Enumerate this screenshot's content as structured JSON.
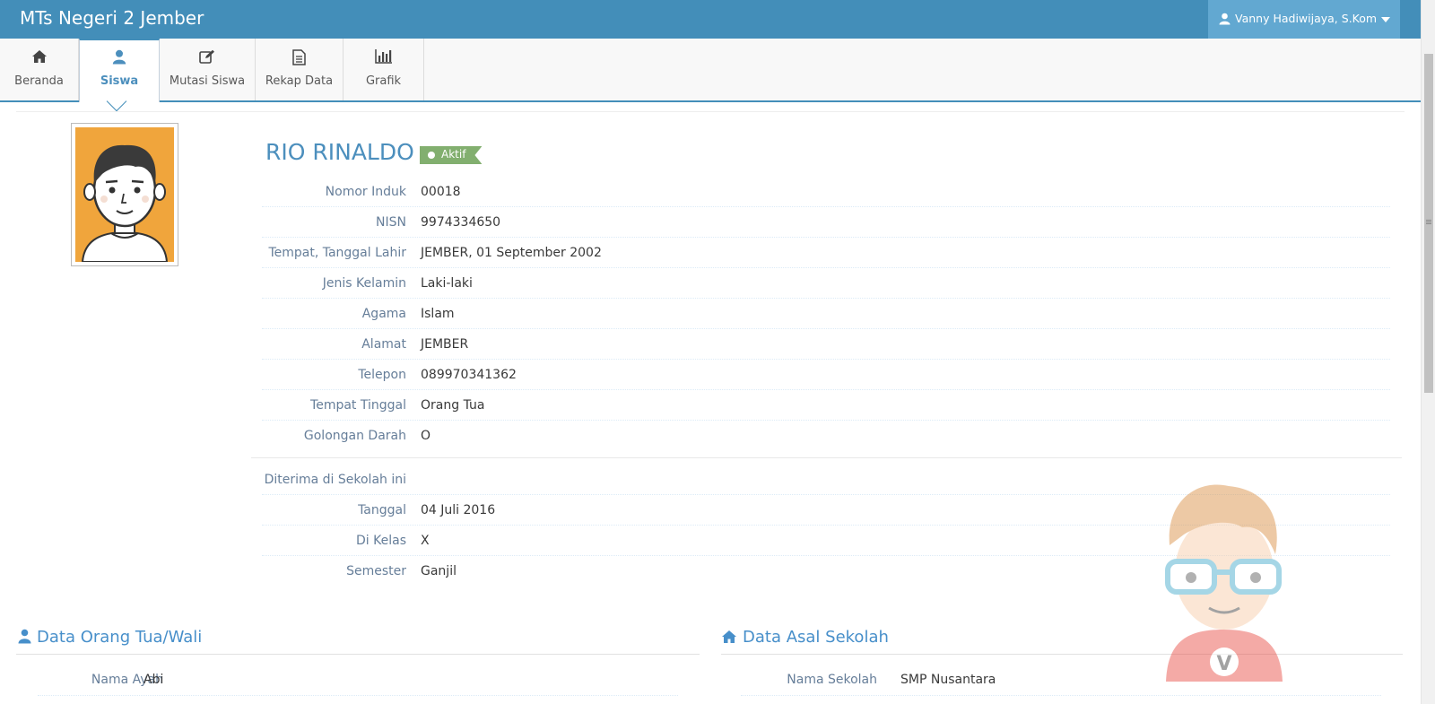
{
  "app": {
    "brand": "MTs Negeri 2 Jember",
    "user_name": "Vanny Hadiwijaya, S.Kom"
  },
  "tabs": [
    {
      "label": "Beranda",
      "icon": "home-icon"
    },
    {
      "label": "Siswa",
      "icon": "user-icon",
      "active": true
    },
    {
      "label": "Mutasi Siswa",
      "icon": "edit-icon"
    },
    {
      "label": "Rekap Data",
      "icon": "file-text-icon"
    },
    {
      "label": "Grafik",
      "icon": "bar-chart-icon"
    }
  ],
  "profile": {
    "name": "RIO RINALDO",
    "status": "Aktif",
    "status_color": "#82af6f",
    "fields": [
      {
        "label": "Nomor Induk",
        "value": "00018"
      },
      {
        "label": "NISN",
        "value": "9974334650"
      },
      {
        "label": "Tempat, Tanggal Lahir",
        "value": "JEMBER, 01 September 2002"
      },
      {
        "label": "Jenis Kelamin",
        "value": "Laki-laki"
      },
      {
        "label": "Agama",
        "value": "Islam"
      },
      {
        "label": "Alamat",
        "value": "JEMBER"
      },
      {
        "label": "Telepon",
        "value": "089970341362"
      },
      {
        "label": "Tempat Tinggal",
        "value": "Orang Tua"
      },
      {
        "label": "Golongan Darah",
        "value": "O"
      }
    ],
    "admission_heading": "Diterima di Sekolah ini",
    "admission": [
      {
        "label": "Tanggal",
        "value": "04 Juli 2016"
      },
      {
        "label": "Di Kelas",
        "value": "X"
      },
      {
        "label": "Semester",
        "value": "Ganjil"
      }
    ]
  },
  "parents": {
    "title": "Data Orang Tua/Wali",
    "icon": "user-icon",
    "fields": [
      {
        "label": "Nama Ayah",
        "value": "Abi"
      }
    ]
  },
  "school_origin": {
    "title": "Data Asal Sekolah",
    "icon": "home-icon",
    "fields": [
      {
        "label": "Nama Sekolah",
        "value": "SMP Nusantara"
      }
    ]
  },
  "colors": {
    "navbar": "#438eb9",
    "user_menu": "#62a8d1",
    "accent_blue": "#4c8fbd",
    "label_gray": "#667e99"
  }
}
